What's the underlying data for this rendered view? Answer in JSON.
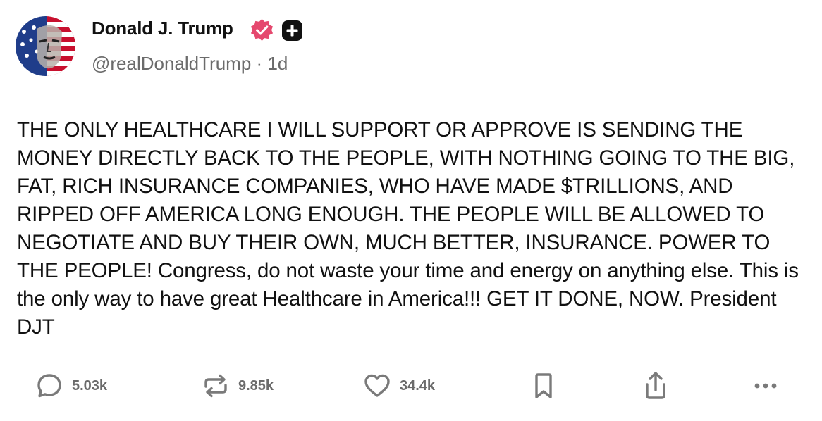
{
  "post": {
    "author": {
      "display_name": "Donald J. Trump",
      "handle": "@realDonaldTrump",
      "separator": "·",
      "age": "1d",
      "verified_icon": "verified-badge-icon",
      "plus_icon": "plus-badge-icon",
      "verified_color": "#e5486e"
    },
    "body": "THE ONLY HEALTHCARE I WILL SUPPORT OR APPROVE IS SENDING THE MONEY DIRECTLY BACK TO THE PEOPLE, WITH NOTHING GOING TO THE BIG, FAT, RICH INSURANCE COMPANIES, WHO HAVE MADE $TRILLIONS, AND RIPPED OFF AMERICA LONG ENOUGH. THE PEOPLE WILL BE ALLOWED TO NEGOTIATE AND BUY THEIR OWN, MUCH BETTER, INSURANCE. POWER TO THE PEOPLE! Congress, do not waste your time and energy on anything else. This is the only way to have great Healthcare in America!!! GET IT DONE, NOW. President DJT",
    "actions": {
      "replies": "5.03k",
      "reposts": "9.85k",
      "likes": "34.4k"
    }
  },
  "icons": {
    "reply": "reply-bubble-icon",
    "repost": "repost-arrows-icon",
    "like": "heart-icon",
    "bookmark": "bookmark-icon",
    "share": "share-upload-icon",
    "more": "more-dots-icon"
  },
  "colors": {
    "text": "#111111",
    "muted": "#6b6b6b",
    "icon": "#7a7a7a"
  }
}
